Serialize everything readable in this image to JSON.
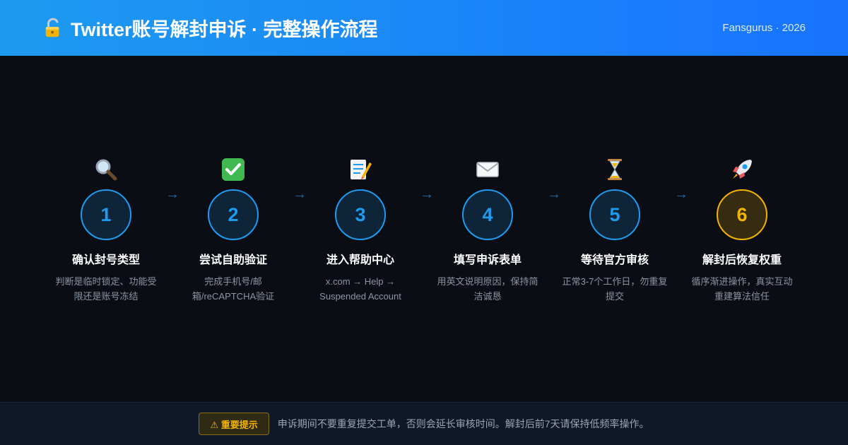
{
  "header": {
    "title": "Twitter账号解封申诉 · 完整操作流程",
    "brand": "Fansgurus · 2026",
    "icon": "lock-open-icon"
  },
  "steps": [
    {
      "number": "1",
      "title": "确认封号类型",
      "desc": "判断是临时锁定、功能受限还是账号冻结",
      "icon": "magnifier-icon"
    },
    {
      "number": "2",
      "title": "尝试自助验证",
      "desc": "完成手机号/邮箱/reCAPTCHA验证",
      "icon": "check-box-icon"
    },
    {
      "number": "3",
      "title": "进入帮助中心",
      "desc": "x.com → Help → Suspended Account",
      "icon": "memo-icon"
    },
    {
      "number": "4",
      "title": "填写申诉表单",
      "desc": "用英文说明原因，保持简洁诚恳",
      "icon": "envelope-icon"
    },
    {
      "number": "5",
      "title": "等待官方审核",
      "desc": "正常3-7个工作日，勿重复提交",
      "icon": "hourglass-icon"
    },
    {
      "number": "6",
      "title": "解封后恢复权重",
      "desc": "循序渐进操作，真实互动重建算法信任",
      "icon": "rocket-icon"
    }
  ],
  "arrow": "→",
  "footer": {
    "badge_label": "⚠ 重要提示",
    "notice": "申诉期间不要重复提交工单，否则会延长审核时间。解封后前7天请保持低频率操作。"
  },
  "colors": {
    "accent": "#1d9bf0",
    "highlight": "#f5b301",
    "background": "#0a0d14"
  }
}
